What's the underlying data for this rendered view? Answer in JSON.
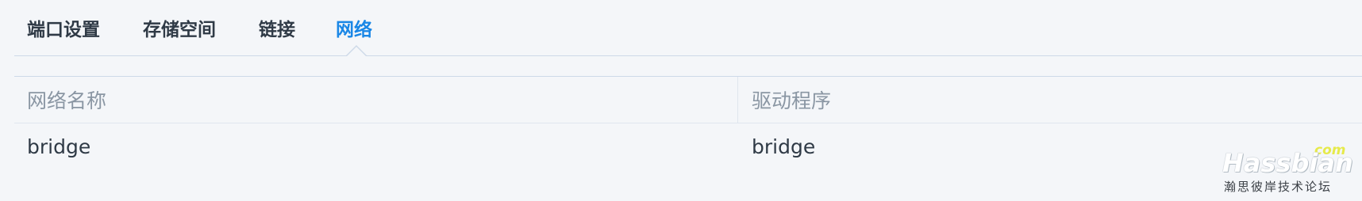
{
  "tabs": [
    {
      "label": "端口设置",
      "active": false
    },
    {
      "label": "存储空间",
      "active": false
    },
    {
      "label": "链接",
      "active": false
    },
    {
      "label": "网络",
      "active": true
    }
  ],
  "table": {
    "columns": [
      "网络名称",
      "驱动程序"
    ],
    "rows": [
      [
        "bridge",
        "bridge"
      ]
    ]
  },
  "watermark": {
    "brand": "Hassbian",
    "suffix": "com",
    "subtitle": "瀚思彼岸技术论坛"
  },
  "colors": {
    "active_tab": "#1a87e6",
    "text": "#2f3a46",
    "header_text": "#8a96a3",
    "background": "#f4f6f9",
    "border": "#cdd9e8"
  }
}
